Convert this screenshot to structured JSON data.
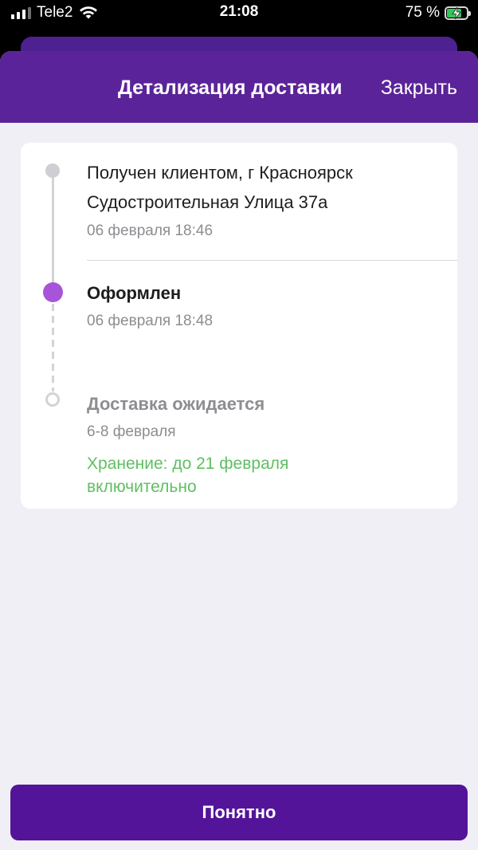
{
  "status_bar": {
    "carrier": "Tele2",
    "time": "21:08",
    "battery_percent": "75 %",
    "battery_level": 0.75,
    "signal_bars": 4,
    "signal_bars_active": 3,
    "icons": [
      "cell-signal-icon",
      "wifi-icon",
      "battery-charging-icon"
    ]
  },
  "header": {
    "title": "Детализация доставки",
    "close_label": "Закрыть"
  },
  "timeline": [
    {
      "status": "done",
      "title_line1": "Получен клиентом, г Красноярск",
      "title_line2": "Судостроительная Улица 37а",
      "date": "06 февраля 18:46"
    },
    {
      "status": "current",
      "title": "Оформлен",
      "date": "06 февраля 18:48"
    },
    {
      "status": "pending",
      "title": "Доставка ожидается",
      "date": "6-8 февраля",
      "storage_note": "Хранение: до 21 февраля включительно"
    }
  ],
  "colors": {
    "header_bg": "#5b2399",
    "accent": "#a754da",
    "button_bg": "#531499",
    "storage_green": "#5fbf62",
    "page_bg": "#f1eff6"
  },
  "button": {
    "label": "Понятно"
  }
}
